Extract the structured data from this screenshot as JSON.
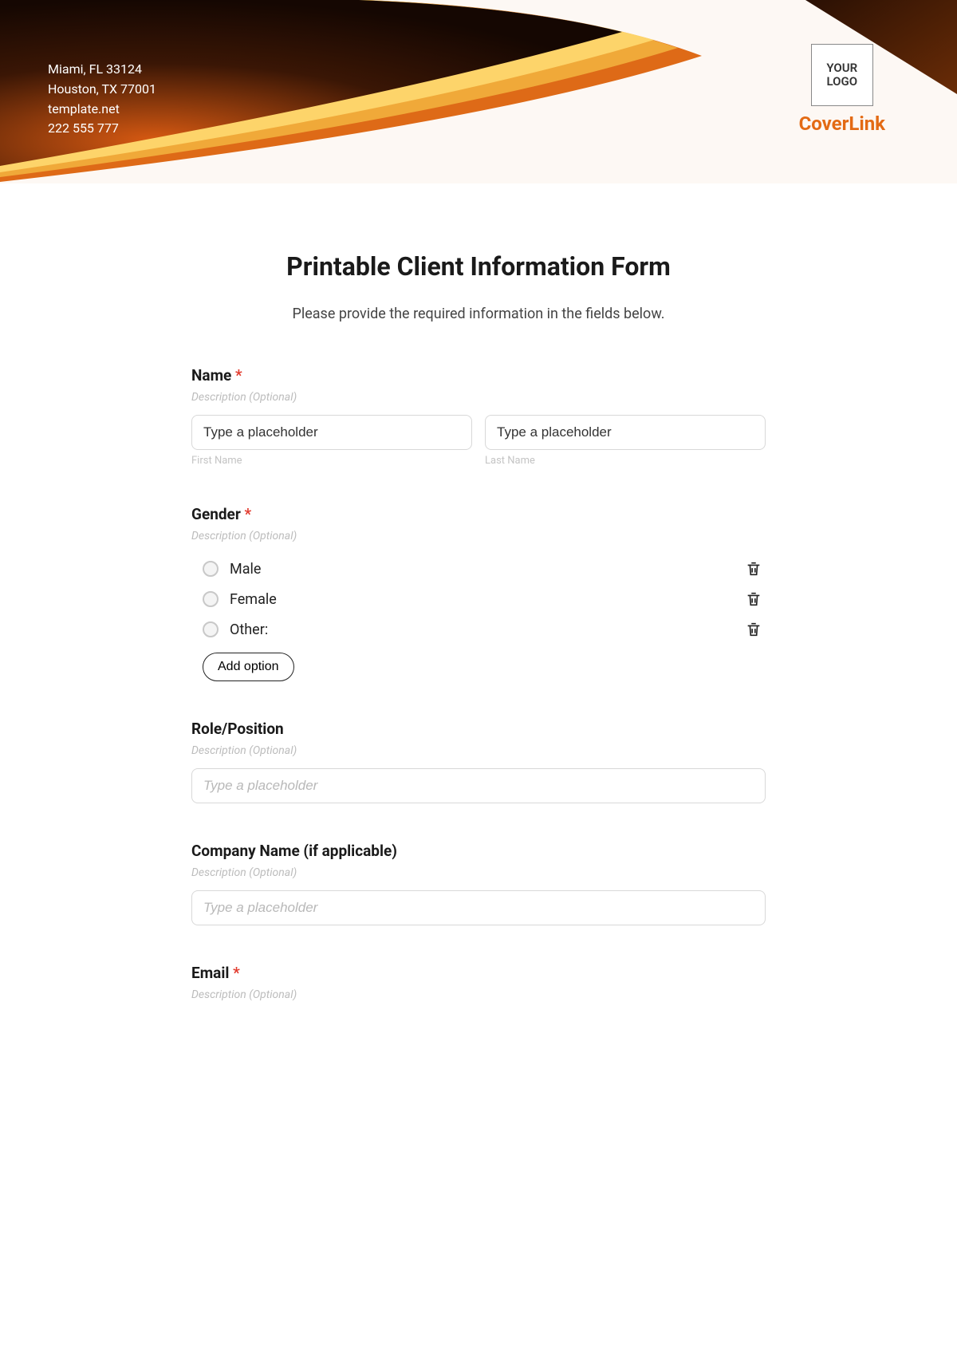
{
  "header": {
    "address": [
      "Miami, FL 33124",
      "Houston, TX 77001",
      "template.net",
      "222 555 777"
    ],
    "logo_text": "YOUR LOGO",
    "brand": "CoverLink"
  },
  "form": {
    "title": "Printable Client Information Form",
    "subtitle": "Please provide the required information in the fields below.",
    "desc_placeholder": "Description (Optional)",
    "fields": {
      "name": {
        "label": "Name",
        "required": "*",
        "first_ph": "Type a placeholder",
        "last_ph": "Type a placeholder",
        "first_under": "First Name",
        "last_under": "Last Name"
      },
      "gender": {
        "label": "Gender",
        "required": "*",
        "options": [
          "Male",
          "Female",
          "Other:"
        ],
        "add_option": "Add option"
      },
      "role": {
        "label": "Role/Position",
        "placeholder": "Type a placeholder"
      },
      "company": {
        "label": "Company Name (if applicable)",
        "placeholder": "Type a placeholder"
      },
      "email": {
        "label": "Email",
        "required": "*"
      }
    }
  }
}
